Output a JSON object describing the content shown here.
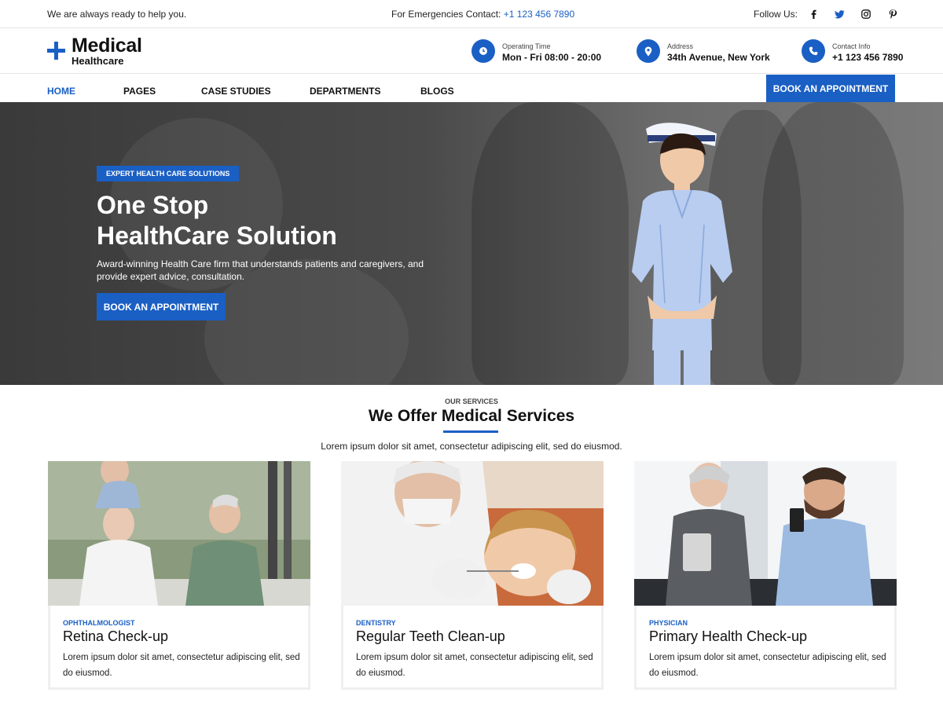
{
  "topbar": {
    "tagline": "We are always ready to help you.",
    "emergency_label": "For Emergencies Contact:",
    "emergency_phone": "+1 123 456 7890",
    "follow_label": "Follow Us:",
    "social_icons": [
      "facebook-icon",
      "twitter-icon",
      "instagram-icon",
      "pinterest-icon"
    ]
  },
  "header": {
    "logo_main": "Medical",
    "logo_sub": "Healthcare",
    "info": [
      {
        "icon": "clock-icon",
        "label": "Operating Time",
        "value": "Mon - Fri 08:00 - 20:00"
      },
      {
        "icon": "map-pin-icon",
        "label": "Address",
        "value": "34th Avenue, New York"
      },
      {
        "icon": "phone-icon",
        "label": "Contact Info",
        "value": "+1 123 456 7890"
      }
    ]
  },
  "nav": {
    "items": [
      "HOME",
      "PAGES",
      "CASE STUDIES",
      "DEPARTMENTS",
      "BLOGS"
    ],
    "active": "HOME",
    "cta": "BOOK AN APPOINTMENT"
  },
  "hero": {
    "badge": "EXPERT HEALTH CARE SOLUTIONS",
    "title_line1": "One Stop",
    "title_line2": "HealthCare Solution",
    "description": "Award-winning Health Care firm that understands patients and caregivers, and provide expert advice, consultation.",
    "cta": "BOOK AN APPOINTMENT"
  },
  "services": {
    "eyebrow": "OUR SERVICES",
    "title": "We Offer Medical Services",
    "description": "Lorem ipsum dolor sit amet, consectetur adipiscing elit, sed do eiusmod.",
    "cards": [
      {
        "category": "OPHTHALMOLOGIST",
        "title": "Retina Check-up",
        "text": "Lorem ipsum dolor sit amet, consectetur adipiscing elit, sed do eiusmod."
      },
      {
        "category": "DENTISTRY",
        "title": "Regular Teeth Clean-up",
        "text": "Lorem ipsum dolor sit amet, consectetur adipiscing elit, sed do eiusmod."
      },
      {
        "category": "PHYSICIAN",
        "title": "Primary Health Check-up",
        "text": "Lorem ipsum dolor sit amet, consectetur adipiscing elit, sed do eiusmod."
      }
    ]
  },
  "colors": {
    "accent": "#1a5fc4",
    "hero_overlay": "#3a3a3a"
  }
}
